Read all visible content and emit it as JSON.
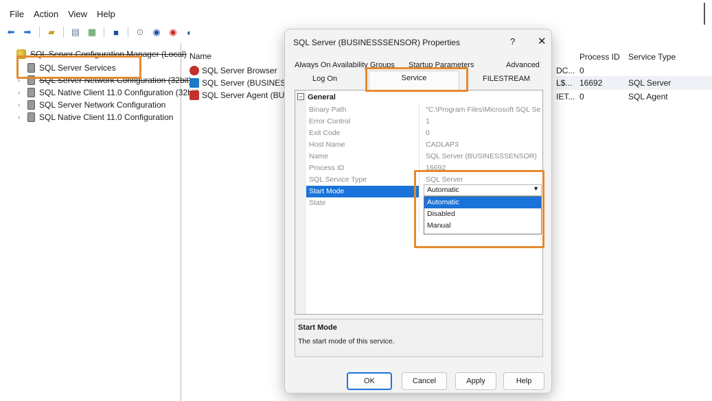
{
  "menu": [
    "File",
    "Action",
    "View",
    "Help"
  ],
  "toolbar": {
    "icons": [
      "back-arrow-icon",
      "forward-arrow-icon",
      "up-folder-icon",
      "show-hide-icon",
      "export-list-icon",
      "help-icon",
      "start-service-icon",
      "pause-service-icon",
      "stop-service-icon",
      "restart-service-icon"
    ]
  },
  "tree": {
    "root": "SQL Server Configuration Manager (Local)",
    "items": [
      "SQL Server Services",
      "SQL Server Network Configuration (32bit)",
      "SQL Native Client 11.0 Configuration (32bit)",
      "SQL Server Network Configuration",
      "SQL Native Client 11.0 Configuration"
    ]
  },
  "list": {
    "headers": {
      "name": "Name",
      "process_id": "Process ID",
      "service_type": "Service Type"
    },
    "rows": [
      {
        "name": "SQL Server Browser",
        "partial": "DC...",
        "process_id": "0",
        "service_type": ""
      },
      {
        "name": "SQL Server (BUSINESSSEN",
        "partial": "L$...",
        "process_id": "16692",
        "service_type": "SQL Server"
      },
      {
        "name": "SQL Server Agent (BUSINE",
        "partial": "IET...",
        "process_id": "0",
        "service_type": "SQL Agent"
      }
    ]
  },
  "dialog": {
    "title": "SQL Server (BUSINESSSENSOR) Properties",
    "help_glyph": "?",
    "close_glyph": "✕",
    "tabs_row1": [
      "Always On Availability Groups",
      "Startup Parameters",
      "Advanced"
    ],
    "tabs_row2": [
      "Log On",
      "Service",
      "FILESTREAM"
    ],
    "active_tab": "Service",
    "category": "General",
    "properties": [
      {
        "name": "Binary Path",
        "value": "\"C:\\Program Files\\Microsoft SQL Serve"
      },
      {
        "name": "Error Control",
        "value": "1"
      },
      {
        "name": "Exit Code",
        "value": "0"
      },
      {
        "name": "Host Name",
        "value": "CADLAP3"
      },
      {
        "name": "Name",
        "value": "SQL Server (BUSINESSSENSOR)"
      },
      {
        "name": "Process ID",
        "value": "16692"
      },
      {
        "name": "SQL Service Type",
        "value": "SQL Server"
      },
      {
        "name": "Start Mode",
        "value": "Automatic"
      },
      {
        "name": "State",
        "value": ""
      }
    ],
    "start_mode_options": [
      "Automatic",
      "Disabled",
      "Manual"
    ],
    "selected_option": "Automatic",
    "description": {
      "title": "Start Mode",
      "text": "The start mode of this service."
    },
    "buttons": {
      "ok": "OK",
      "cancel": "Cancel",
      "apply": "Apply",
      "help": "Help"
    }
  },
  "colors": {
    "highlight": "#e58a2f",
    "selection": "#1a73d9"
  }
}
